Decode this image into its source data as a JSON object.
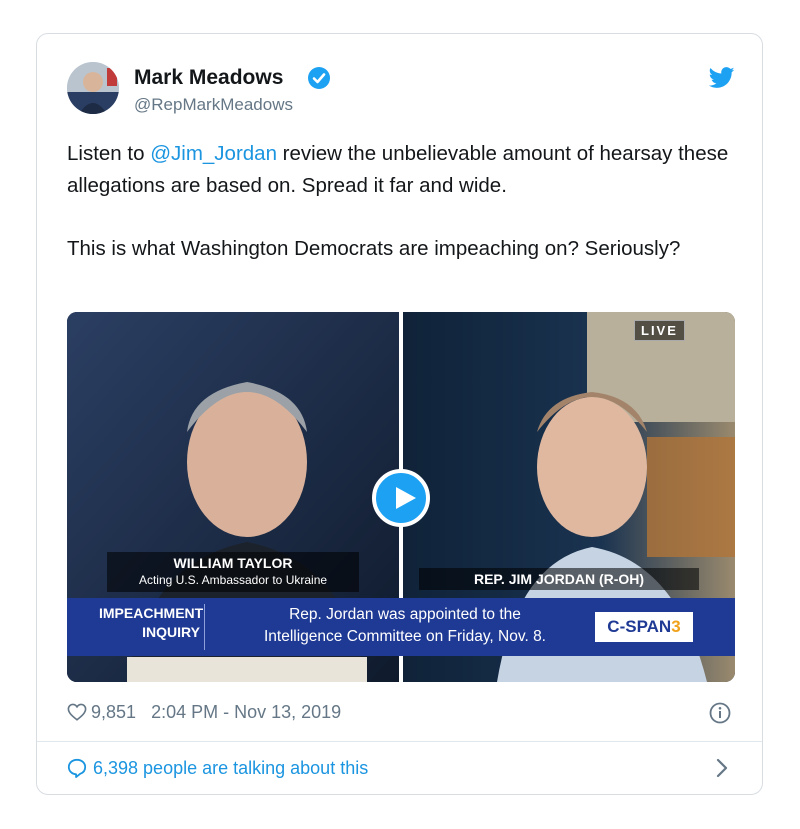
{
  "tweet": {
    "author_name": "Mark Meadows",
    "author_handle": "@RepMarkMeadows",
    "text_line1_prefix": "Listen to ",
    "mention": "@Jim_Jordan",
    "text_line1_suffix": " review the unbelievable amount of hearsay these allegations are based on. Spread it far and wide.",
    "text_para2": "This is what Washington Democrats are impeaching on? Seriously?",
    "likes": "9,851",
    "timestamp": "2:04 PM - Nov 13, 2019",
    "talking": "6,398 people are talking about this"
  },
  "video": {
    "live_badge": "LIVE",
    "left_caption_name": "WILLIAM TAYLOR",
    "left_caption_title": "Acting U.S. Ambassador to Ukraine",
    "right_caption": "REP. JIM JORDAN (R-OH)",
    "banner_tag_line1": "IMPEACHMENT",
    "banner_tag_line2": "INQUIRY",
    "banner_msg_line1": "Rep. Jordan was appointed to the",
    "banner_msg_line2": "Intelligence Committee on Friday, Nov. 8.",
    "network_main": "C-SPAN",
    "network_num": "3"
  },
  "icons": {
    "verified": "verified-badge-icon",
    "bird": "twitter-bird-icon",
    "heart": "heart-icon",
    "info": "info-icon",
    "bubble": "speech-bubble-icon",
    "chevron": "chevron-right-icon",
    "play": "play-icon"
  },
  "colors": {
    "accent": "#1da1f2",
    "link": "#1b95e0",
    "muted": "#657786",
    "banner": "#1f3a94"
  }
}
